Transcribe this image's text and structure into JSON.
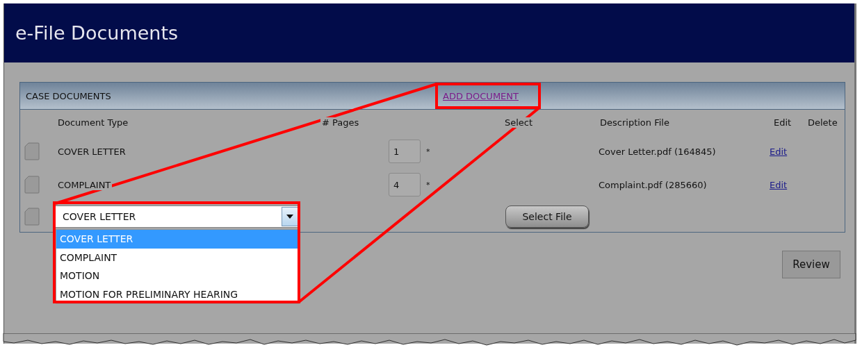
{
  "page": {
    "title": "e-File Documents"
  },
  "panel": {
    "title": "CASE DOCUMENTS",
    "add_link": "ADD DOCUMENT"
  },
  "columns": [
    "Document Type",
    "# Pages",
    "Select",
    "Description File",
    "Edit",
    "Delete"
  ],
  "rows": [
    {
      "document_type": "COVER LETTER",
      "pages": "1",
      "required_mark": "*",
      "file": "Cover Letter.pdf (164845)",
      "edit": "Edit"
    },
    {
      "document_type": "COMPLAINT",
      "pages": "4",
      "required_mark": "*",
      "file": "Complaint.pdf (285660)",
      "edit": "Edit"
    }
  ],
  "new_row": {
    "document_type": "COVER LETTER",
    "button": "Select File",
    "options": [
      {
        "label": "COVER LETTER",
        "selected": true
      },
      {
        "label": "COMPLAINT",
        "selected": false
      },
      {
        "label": "MOTION",
        "selected": false
      },
      {
        "label": "MOTION FOR PRELIMINARY HEARING",
        "selected": false
      }
    ]
  },
  "review_button": "Review"
}
